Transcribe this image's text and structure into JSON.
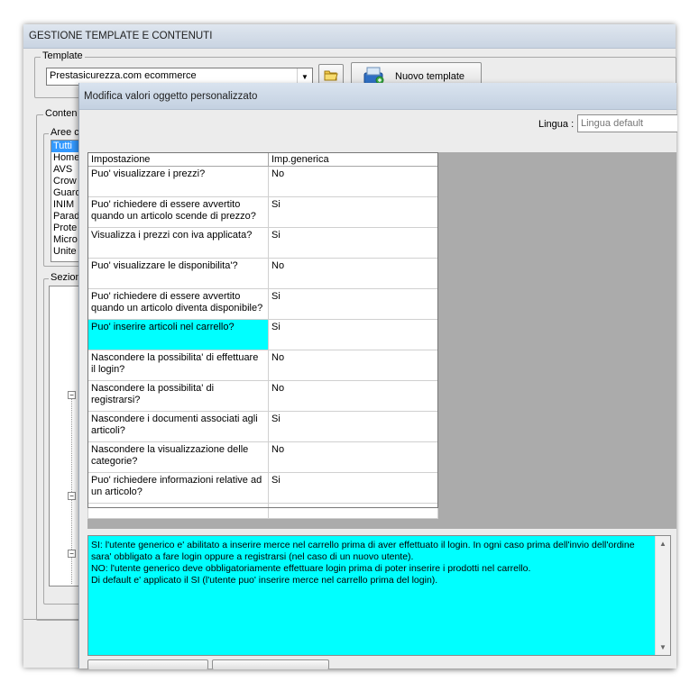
{
  "back_window": {
    "title": "GESTIONE TEMPLATE E CONTENUTI",
    "template_group_label": "Template",
    "template_value": "Prestasicurezza.com ecommerce",
    "new_template_label": "Nuovo template",
    "contenuti_label": "Conten",
    "aree_label": "Aree c",
    "sezioni_label": "Sezion",
    "areas": [
      "Tutti",
      "Home",
      "AVS",
      "Crow",
      "Guard",
      "INIM",
      "Parad",
      "Prote",
      "Micro",
      "Unite"
    ],
    "selected_area_index": 0
  },
  "dialog": {
    "title": "Modifica valori oggetto personalizzato",
    "lingua_label": "Lingua :",
    "lingua_placeholder": "Lingua default",
    "grid": {
      "columns": [
        "Impostazione",
        "Imp.generica"
      ],
      "rows": [
        {
          "setting": "Puo' visualizzare i prezzi?",
          "value": "No"
        },
        {
          "setting": "Puo' richiedere di essere avvertito quando un articolo scende di prezzo?",
          "value": "Si"
        },
        {
          "setting": "Visualizza i prezzi con iva applicata?",
          "value": "Si"
        },
        {
          "setting": "Puo' visualizzare le disponibilita'?",
          "value": "No"
        },
        {
          "setting": "Puo' richiedere di essere avvertito quando un articolo diventa disponibile?",
          "value": "Si"
        },
        {
          "setting": "Puo' inserire articoli nel carrello?",
          "value": "Si"
        },
        {
          "setting": "Nascondere la possibilita' di effettuare il login?",
          "value": "No"
        },
        {
          "setting": "Nascondere la possibilita' di registrarsi?",
          "value": "No"
        },
        {
          "setting": "Nascondere i documenti associati agli articoli?",
          "value": "Si"
        },
        {
          "setting": "Nascondere la visualizzazione delle categorie?",
          "value": "No"
        },
        {
          "setting": "Puo' richiedere informazioni relative ad un articolo?",
          "value": "Si"
        }
      ],
      "selected_row_index": 5
    },
    "description": "SI: l'utente generico e' abilitato a inserire merce nel carrello prima di aver effettuato il login. In ogni caso prima dell'invio dell'ordine sara' obbligato a fare login oppure a registrarsi (nel caso di un nuovo utente).\nNO: l'utente generico deve obbligatoriamente effettuare login prima di poter inserire i prodotti nel carrello.\nDi default e' applicato il SI (l'utente puo' inserire merce nel carrello prima del login).",
    "colors": {
      "selection": "#00ffff",
      "grid_background": "#ababab"
    }
  }
}
